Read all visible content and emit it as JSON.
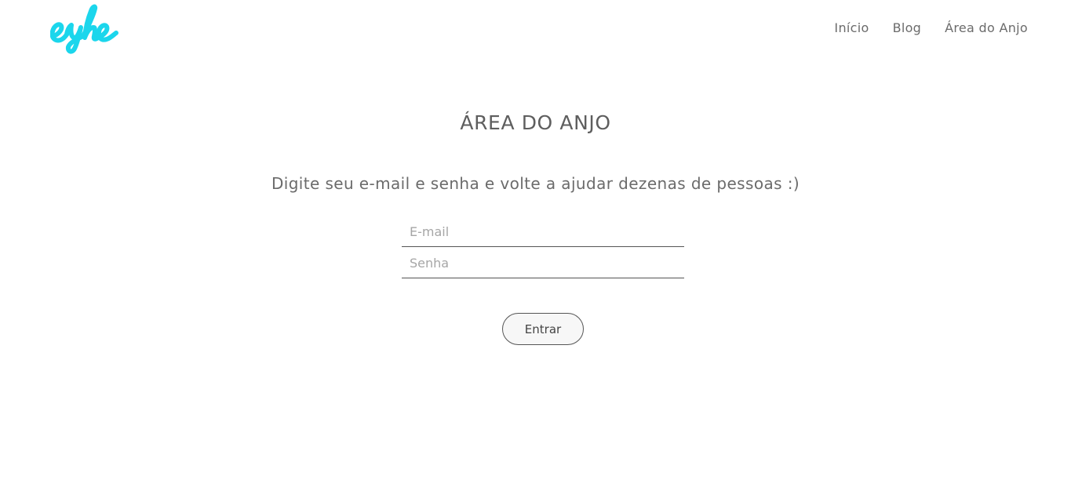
{
  "header": {
    "logo_text": "eyhe",
    "logo_color": "#1bd6ec",
    "nav": [
      {
        "label": "Início"
      },
      {
        "label": "Blog"
      },
      {
        "label": "Área do Anjo"
      }
    ]
  },
  "main": {
    "title": "ÁREA DO ANJO",
    "subtitle": "Digite seu e-mail e senha e volte a ajudar dezenas de pessoas :)",
    "email_placeholder": "E-mail",
    "senha_placeholder": "Senha",
    "submit_label": "Entrar"
  }
}
